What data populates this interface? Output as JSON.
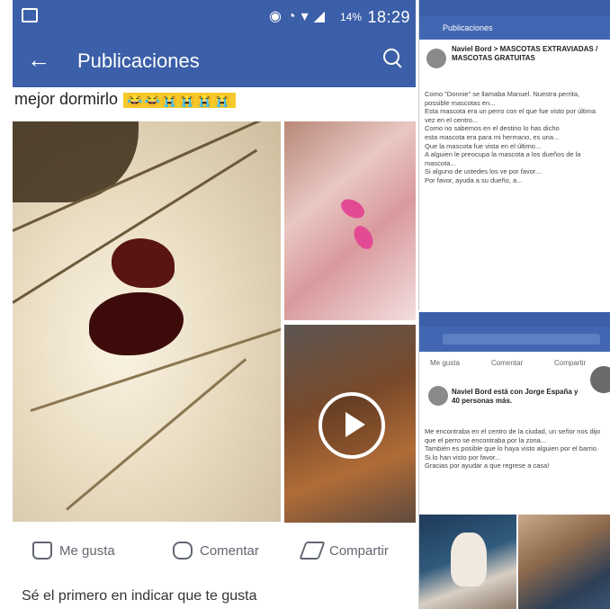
{
  "status_bar": {
    "battery": "14%",
    "time": "18:29"
  },
  "app_bar": {
    "back_glyph": "←",
    "title": "Publicaciones"
  },
  "post": {
    "caption": "mejor dormirlo",
    "caption_emojis": "😂😂😭😭😭😭"
  },
  "actions": {
    "like": "Me gusta",
    "comment": "Comentar",
    "share": "Compartir"
  },
  "first_like_prompt": "Sé el primero en indicar que te gusta",
  "right_top": {
    "title": "Publicaciones",
    "header": "Naviel Bord > MASCOTAS EXTRAVIADAS / MASCOTAS GRATUITAS",
    "body": "Como \"Donnie\" se llamaba Manuel. Nuestra perrita, possible mascotas en...\nEsta mascota era un perro con el que fue visto por última vez en el centro...\nComo no sabemos en el destino lo has dicho\nesta mascota era para mi hermano, es una...\nQue la mascota fue vista en el último...\nA alguien le preocupa la mascota a los dueños de la mascota...\nSi alguno de ustedes los ve por favor...\nPor favor, ayuda a su dueño, a..."
  },
  "right_bottom": {
    "tabs": [
      "Me gusta",
      "Comentar",
      "Compartir"
    ],
    "header": "Naviel Bord está con Jorge España y 40 personas más.",
    "body": "Me encontraba en el centro de la ciudad, un señor nos dijo que el perro se encontraba por la zona...\nTambién es posible que lo haya visto alguien por el barrio. Si lo han visto por favor...\nGracias por ayudar a que regrese a casa!"
  }
}
